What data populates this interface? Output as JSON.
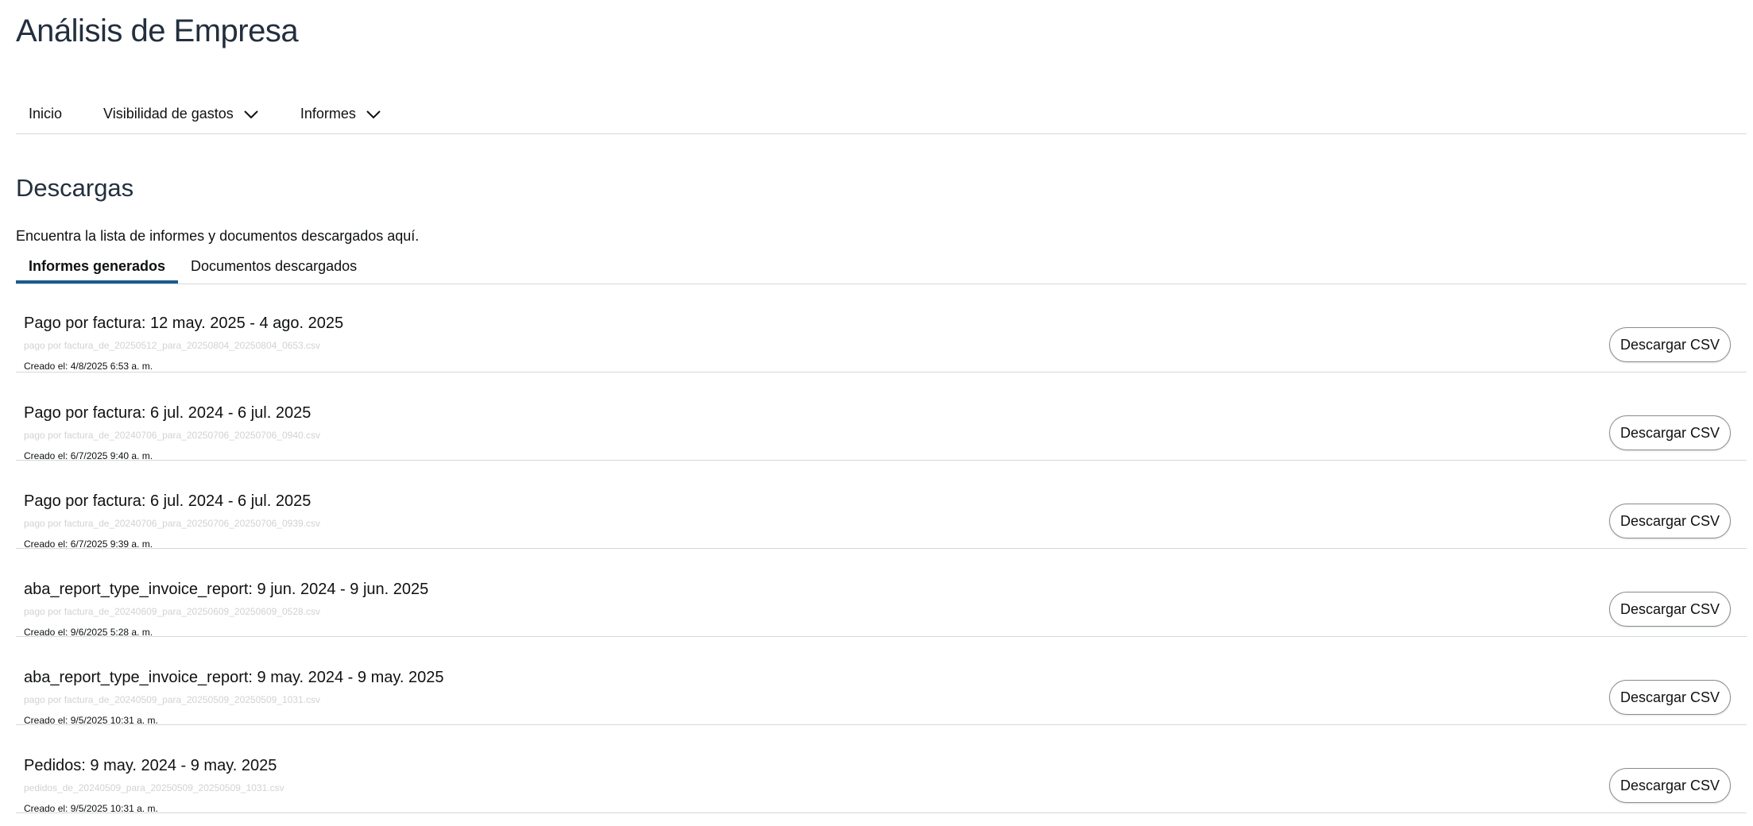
{
  "app": {
    "title": "Análisis de Empresa"
  },
  "nav": {
    "items": [
      {
        "label": "Inicio",
        "has_dropdown": false
      },
      {
        "label": "Visibilidad de gastos",
        "has_dropdown": true
      },
      {
        "label": "Informes",
        "has_dropdown": true
      }
    ]
  },
  "page": {
    "title": "Descargas",
    "subtitle": "Encuentra la lista de informes y documentos descargados aquí."
  },
  "tabs": [
    {
      "label": "Informes generados",
      "active": true
    },
    {
      "label": "Documentos descargados",
      "active": false
    }
  ],
  "reports": [
    {
      "title": "Pago por factura: 12 may. 2025 - 4 ago. 2025",
      "file": "pago por factura_de_20250512_para_20250804_20250804_0653.csv",
      "created": "Creado el: 4/8/2025 6:53 a. m.",
      "button": "Descargar CSV"
    },
    {
      "title": "Pago por factura: 6 jul. 2024 - 6 jul. 2025",
      "file": "pago por factura_de_20240706_para_20250706_20250706_0940.csv",
      "created": "Creado el: 6/7/2025 9:40 a. m.",
      "button": "Descargar CSV"
    },
    {
      "title": "Pago por factura: 6 jul. 2024 - 6 jul. 2025",
      "file": "pago por factura_de_20240706_para_20250706_20250706_0939.csv",
      "created": "Creado el: 6/7/2025 9:39 a. m.",
      "button": "Descargar CSV"
    },
    {
      "title": "aba_report_type_invoice_report: 9 jun. 2024 - 9 jun. 2025",
      "file": "pago por factura_de_20240609_para_20250609_20250609_0528.csv",
      "created": "Creado el: 9/6/2025 5:28 a. m.",
      "button": "Descargar CSV"
    },
    {
      "title": "aba_report_type_invoice_report: 9 may. 2024 - 9 may. 2025",
      "file": "pago por factura_de_20240509_para_20250509_20250509_1031.csv",
      "created": "Creado el: 9/5/2025 10:31 a. m.",
      "button": "Descargar CSV"
    },
    {
      "title": "Pedidos: 9 may. 2024 - 9 may. 2025",
      "file": "pedidos_de_20240509_para_20250509_20250509_1031.csv",
      "created": "Creado el: 9/5/2025 10:31 a. m.",
      "button": "Descargar CSV"
    }
  ]
}
